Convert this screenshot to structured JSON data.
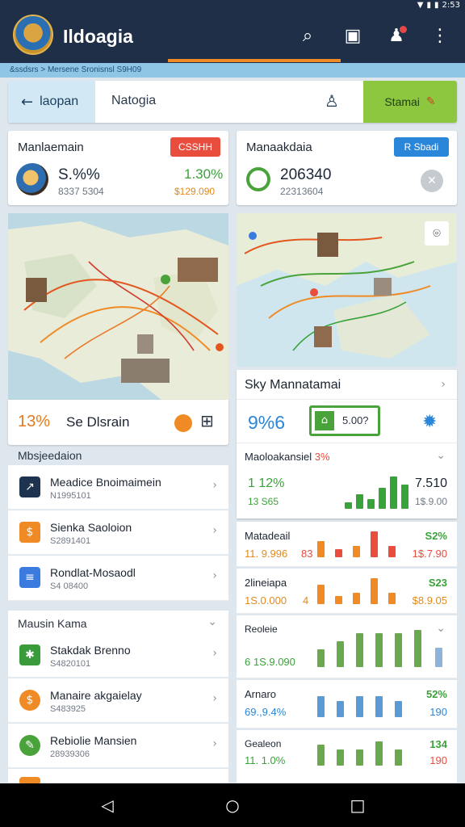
{
  "status": {
    "time": "2:53"
  },
  "app": {
    "title": "Ildoagia",
    "subtitle": "&ssdsrs > Mersene Sronisnsl S9H09"
  },
  "nav": {
    "back_label": "laopan",
    "title": "Natogia",
    "action_label": "Stamai"
  },
  "stats": [
    {
      "title": "Manlaemain",
      "badge": "CSSHH",
      "badge_color": "#e84d3d",
      "value": "S.%%",
      "sub": "8337 5304",
      "change": "1.30%",
      "change_sub": "$129.090"
    },
    {
      "title": "Manaakdaia",
      "badge": "R Sbadi",
      "badge_color": "#2a86d8",
      "value": "206340",
      "sub": "22313604"
    }
  ],
  "map_footer": {
    "value": "13%",
    "label": "Se Dlsrain"
  },
  "left_list": {
    "header": "Mbsjeedaion",
    "items": [
      {
        "title": "Meadice Bnoimaimein",
        "sub": "N1995101",
        "icon": "chart-icon",
        "color": "#1e3350"
      },
      {
        "title": "Sienka Saoloion",
        "sub": "S2891401",
        "icon": "dollar-icon",
        "color": "#f08a25"
      },
      {
        "title": "Rondlat-Mosaodl",
        "sub": "S4 08400",
        "icon": "document-icon",
        "color": "#3b7be0"
      }
    ]
  },
  "left_list2": {
    "header": "Mausin Kama",
    "items": [
      {
        "title": "Stakdak Brenno",
        "sub": "S4820101",
        "icon": "chart-icon",
        "color": "#3a9b3a"
      },
      {
        "title": "Manaire akgaielay",
        "sub": "S483925",
        "icon": "dollar-icon",
        "color": "#f08a25"
      },
      {
        "title": "Rebiolie Mansien",
        "sub": "28939306",
        "icon": "document-icon",
        "color": "#4aa33a"
      }
    ]
  },
  "right_panel": {
    "header": "Sky Mannatamai",
    "headline": {
      "value": "9%6",
      "box_label": "5.00?"
    },
    "chart_card": {
      "title": "Maoloakansiel",
      "pct": "3%",
      "left_top": "1 12%",
      "left_bottom": "13 S65",
      "right_top": "7.510",
      "right_bottom": "1$.9.00"
    }
  },
  "bar_rows": [
    {
      "title": "Matadeail",
      "badge": "S2%",
      "badge_color": "#3aa23a",
      "left": "11. 9.996",
      "mid": "83",
      "right": "1$.7.90"
    },
    {
      "title": "2lineiapa",
      "badge": "S23",
      "badge_color": "#3aa23a",
      "left": "1S.0.000",
      "mid": "4",
      "right": "$8.9.05"
    },
    {
      "title": "Reoleie",
      "badge": "",
      "badge_color": "#3aa23a",
      "left": "6 1S.9.090",
      "mid": "",
      "right": ""
    },
    {
      "title": "Arnaro",
      "badge": "52%",
      "badge_color": "#3aa23a",
      "left": "69.,9.4%",
      "mid": "",
      "right": "190"
    },
    {
      "title": "Gealeon",
      "badge": "134",
      "badge_color": "#3aa23a",
      "left": "11. 1.0%",
      "mid": "",
      "right": "190"
    }
  ]
}
